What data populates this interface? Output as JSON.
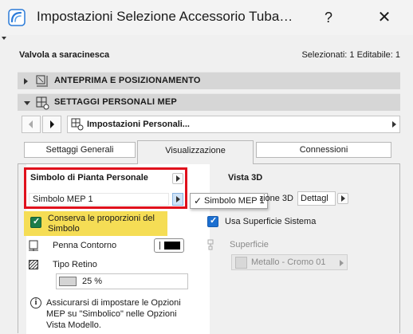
{
  "window": {
    "title": "Impostazioni Selezione Accessorio Tuba…",
    "help_label": "?",
    "close_label": "✕"
  },
  "header": {
    "object_name": "Valvola a saracinesca",
    "selection_info": "Selezionati: 1 Editabile: 1"
  },
  "sections": [
    {
      "label": "ANTEPRIMA E POSIZIONAMENTO",
      "expanded": false
    },
    {
      "label": "SETTAGGI PERSONALI MEP",
      "expanded": true
    }
  ],
  "nav": {
    "selector_label": "Impostazioni Personali..."
  },
  "tabs": [
    {
      "label": "Settaggi Generali",
      "active": false
    },
    {
      "label": "Visualizzazione",
      "active": true
    },
    {
      "label": "Connessioni",
      "active": false
    }
  ],
  "left": {
    "symbol_title": "Simbolo di Pianta Personale",
    "symbol_value": "Simbolo MEP 1",
    "popup_item": "Simbolo MEP 1",
    "keep_proportions": "Conserva le proporzioni del Simbolo",
    "keep_proportions_checked": true,
    "pen_label": "Penna Contorno",
    "fill_type_label": "Tipo Retino",
    "fill_value": "25 %",
    "info_text": "Assicurarsi di impostare le Opzioni MEP su \"Simbolico\" nelle Opzioni Vista Modello."
  },
  "right": {
    "view3d_title": "Vista 3D",
    "view3d_row_label": "Visualizzazione 3D",
    "view3d_value": "Dettagl",
    "use_surface_label": "Usa Superficie Sistema",
    "use_surface_checked": true,
    "surface_label": "Superficie",
    "material_value": "Metallo - Cromo 01"
  },
  "colors": {
    "highlight_box": "#e0101c",
    "keep_background": "#f5dd55",
    "checkbox_green": "#1e7d4a",
    "checkbox_blue": "#1c6fd0"
  }
}
